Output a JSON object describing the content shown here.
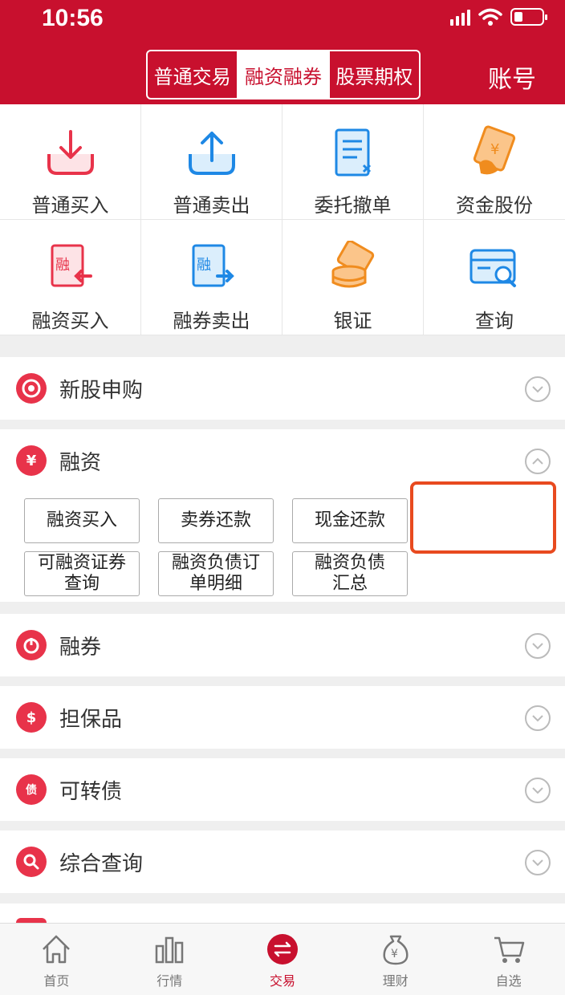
{
  "status_bar": {
    "time": "10:56",
    "battery_level": 0.3
  },
  "header": {
    "tabs": [
      {
        "label": "普通交易",
        "active": false
      },
      {
        "label": "融资融券",
        "active": true
      },
      {
        "label": "股票期权",
        "active": false
      }
    ],
    "account_label": "账号"
  },
  "quick_actions": [
    {
      "label": "普通买入",
      "icon": "download-tray-icon"
    },
    {
      "label": "普通卖出",
      "icon": "upload-tray-icon"
    },
    {
      "label": "委托撤单",
      "icon": "document-cancel-icon"
    },
    {
      "label": "资金股份",
      "icon": "coin-card-icon"
    },
    {
      "label": "融资买入",
      "icon": "margin-buy-icon"
    },
    {
      "label": "融券卖出",
      "icon": "short-sell-icon"
    },
    {
      "label": "银证",
      "icon": "coin-stack-icon"
    },
    {
      "label": "查询",
      "icon": "card-search-icon"
    }
  ],
  "sections": {
    "ipo": {
      "title": "新股申购",
      "icon_text": "",
      "expanded": false
    },
    "margin": {
      "title": "融资",
      "expanded": true,
      "buttons": [
        "融资买入",
        "卖券还款",
        "现金还款",
        "可融资证券查询",
        "融资负债订单明细",
        "融资负债汇总"
      ],
      "button_lines": [
        [
          "融资买入"
        ],
        [
          "卖券还款"
        ],
        [
          "现金还款"
        ],
        [
          "可融资证券",
          "查询"
        ],
        [
          "融资负债订",
          "单明细"
        ],
        [
          "融资负债",
          "汇总"
        ]
      ]
    },
    "short": {
      "title": "融券",
      "expanded": false
    },
    "collateral": {
      "title": "担保品",
      "icon_text": "$",
      "expanded": false
    },
    "convertible": {
      "title": "可转债",
      "icon_text": "债",
      "expanded": false
    },
    "query": {
      "title": "综合查询",
      "expanded": false
    }
  },
  "tabbar": [
    {
      "label": "首页",
      "icon": "home-icon",
      "active": false
    },
    {
      "label": "行情",
      "icon": "bar-chart-icon",
      "active": false
    },
    {
      "label": "交易",
      "icon": "exchange-icon",
      "active": true
    },
    {
      "label": "理财",
      "icon": "money-bag-icon",
      "active": false
    },
    {
      "label": "自选",
      "icon": "cart-icon",
      "active": false
    }
  ],
  "colors": {
    "brand": "#c8102e",
    "highlight": "#e84a1f"
  }
}
